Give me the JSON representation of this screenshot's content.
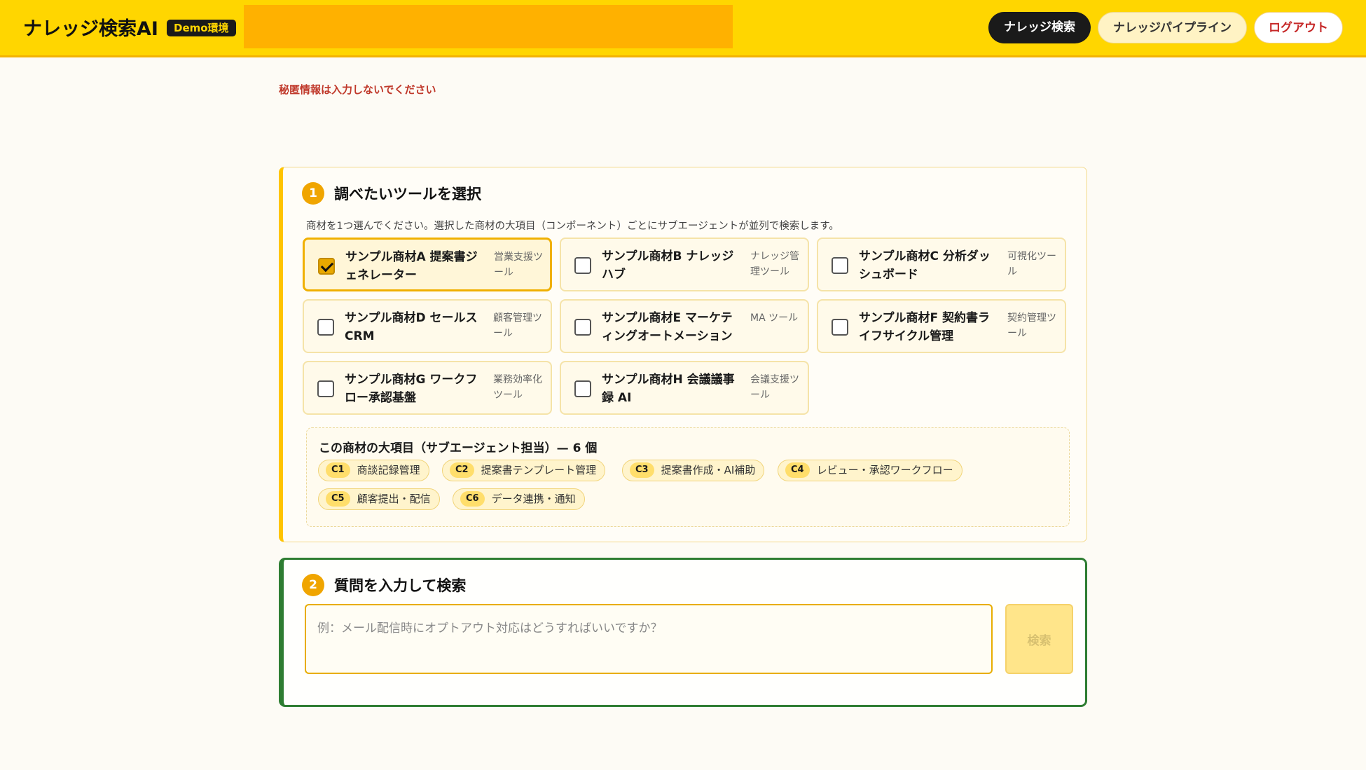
{
  "header": {
    "brand": "ナレッジ検索AI",
    "env_badge": "Demo環境",
    "nav": {
      "search": "ナレッジ検索",
      "pipeline": "ナレッジパイプライン",
      "logout": "ログアウト"
    }
  },
  "warning": "秘匿情報は入力しないでください",
  "step1": {
    "number": "1",
    "title": "調べたいツールを選択",
    "description": "商材を1つ選んでください。選択した商材の大項目（コンポーネント）ごとにサブエージェントが並列で検索します。",
    "tools": [
      {
        "name": "サンプル商材A 提案書ジェネレーター",
        "category": "営業支援ツール",
        "checked": true
      },
      {
        "name": "サンプル商材B ナレッジハブ",
        "category": "ナレッジ管理ツール",
        "checked": false
      },
      {
        "name": "サンプル商材C 分析ダッシュボード",
        "category": "可視化ツール",
        "checked": false
      },
      {
        "name": "サンプル商材D セールス CRM",
        "category": "顧客管理ツール",
        "checked": false
      },
      {
        "name": "サンプル商材E マーケティングオートメーション",
        "category": "MA ツール",
        "checked": false
      },
      {
        "name": "サンプル商材F 契約書ライフサイクル管理",
        "category": "契約管理ツール",
        "checked": false
      },
      {
        "name": "サンプル商材G ワークフロー承認基盤",
        "category": "業務効率化ツール",
        "checked": false
      },
      {
        "name": "サンプル商材H 会議議事録 AI",
        "category": "会議支援ツール",
        "checked": false
      }
    ],
    "components_title": "この商材の大項目（サブエージェント担当）— 6 個",
    "components": [
      {
        "code": "C1",
        "label": "商談記録管理"
      },
      {
        "code": "C2",
        "label": "提案書テンプレート管理"
      },
      {
        "code": "C3",
        "label": "提案書作成・AI補助"
      },
      {
        "code": "C4",
        "label": "レビュー・承認ワークフロー"
      },
      {
        "code": "C5",
        "label": "顧客提出・配信"
      },
      {
        "code": "C6",
        "label": "データ連携・通知"
      }
    ]
  },
  "step2": {
    "number": "2",
    "title": "質問を入力して検索",
    "placeholder": "例：メール配信時にオプトアウト対応はどうすればいいですか？",
    "search_button": "検索"
  }
}
